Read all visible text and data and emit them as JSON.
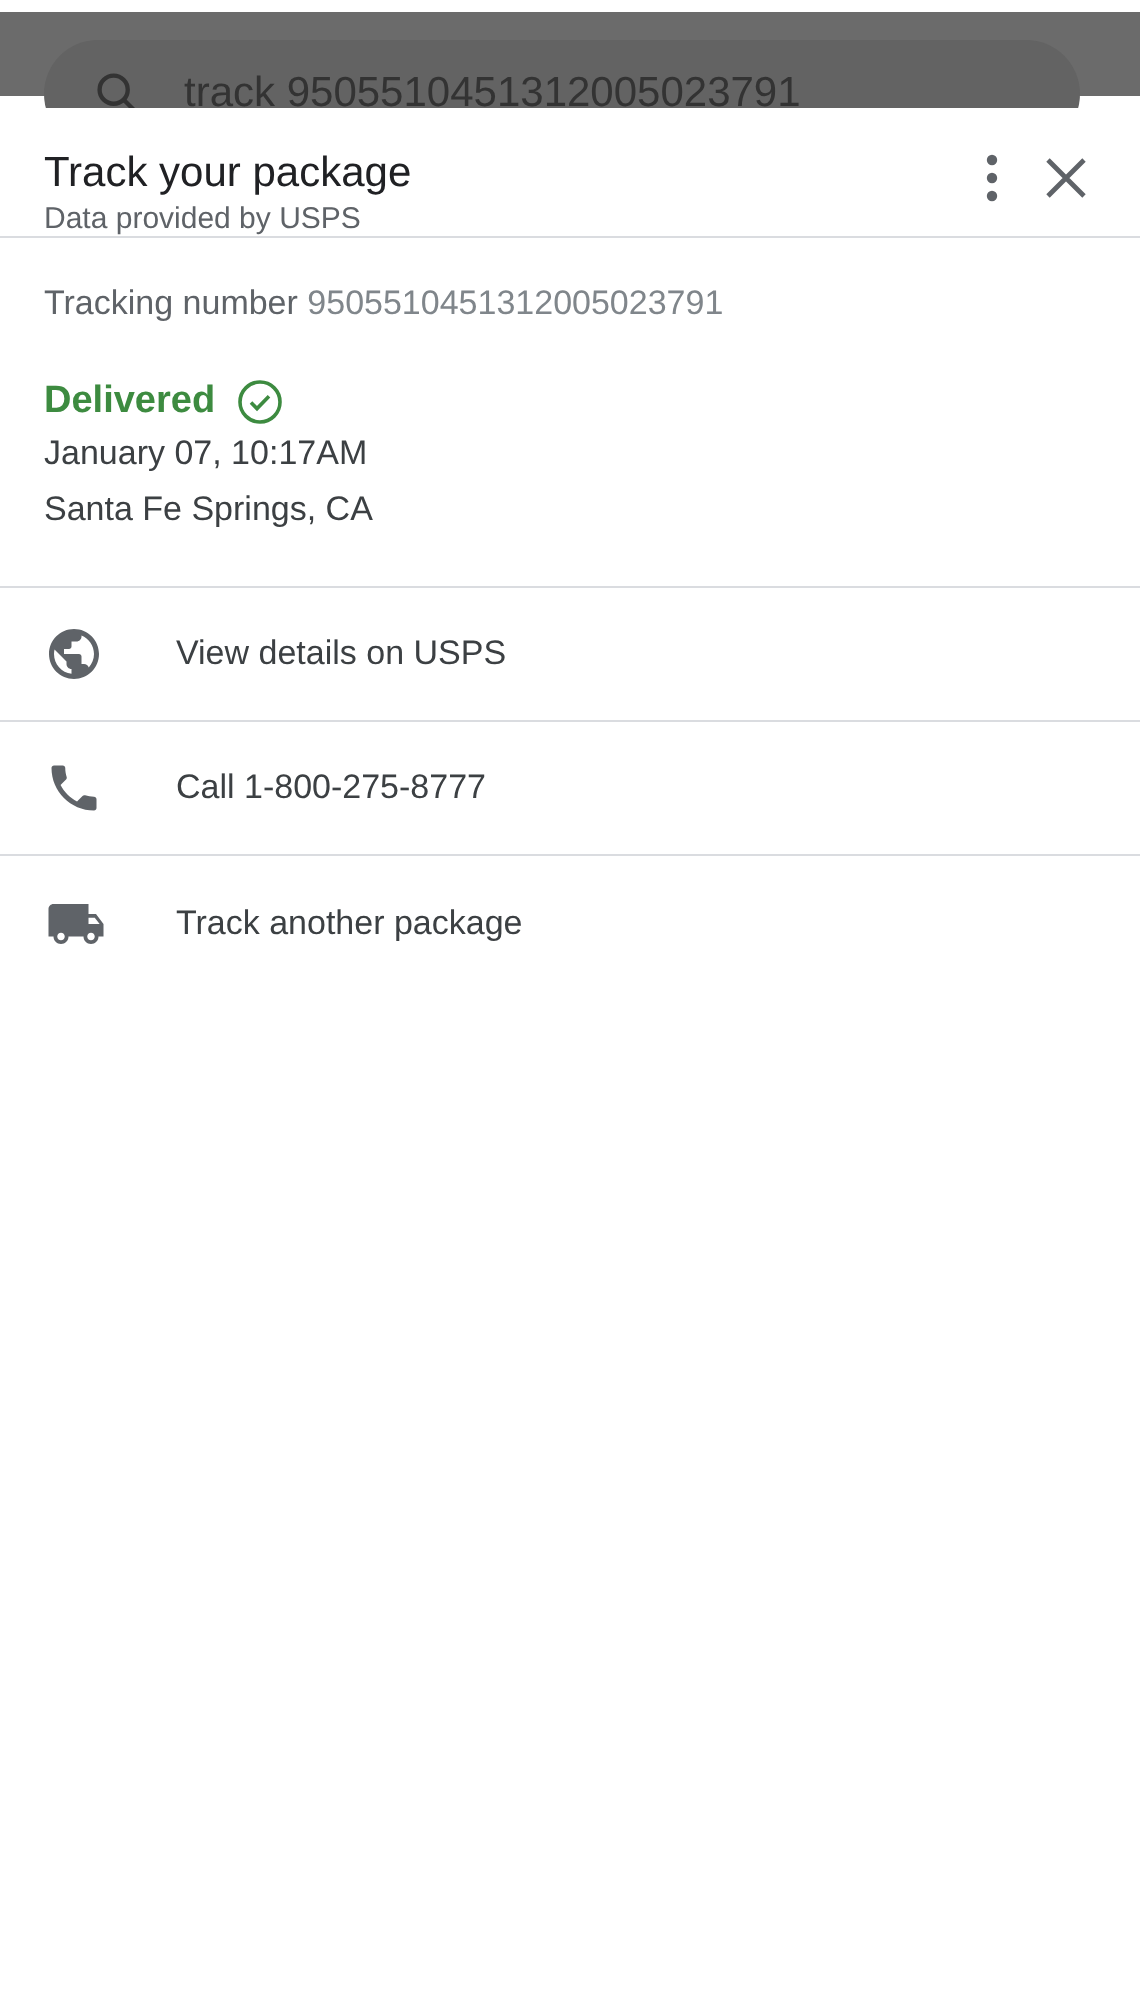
{
  "search": {
    "value": "track 9505510451312005023791"
  },
  "sheet": {
    "title": "Track your package",
    "subtitle": "Data provided by USPS"
  },
  "tracking": {
    "label": "Tracking number",
    "number": "9505510451312005023791"
  },
  "status": {
    "text": "Delivered",
    "kind": "delivered",
    "color": "#3d8b40",
    "date": "January 07, 10:17AM",
    "location": "Santa Fe Springs, CA"
  },
  "actions": [
    {
      "kind": "globe",
      "label": "View details on USPS"
    },
    {
      "kind": "phone",
      "label": "Call 1-800-275-8777"
    },
    {
      "kind": "truck",
      "label": "Track another package"
    }
  ]
}
